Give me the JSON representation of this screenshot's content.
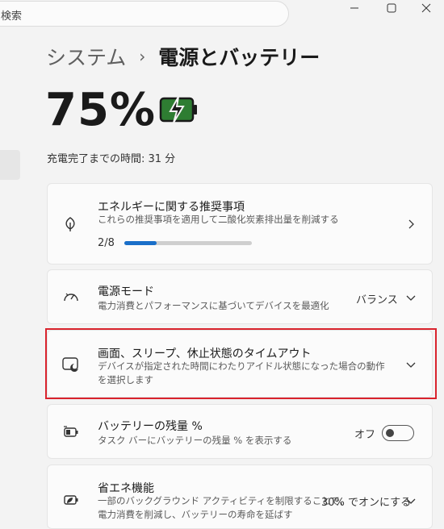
{
  "search": {
    "text": "検索"
  },
  "breadcrumb": {
    "parent": "システム",
    "separator": "›",
    "current": "電源とバッテリー"
  },
  "battery": {
    "percent": "75%",
    "charge_time": "充電完了までの時間: 31 分",
    "charging_color": "#2e7d32"
  },
  "cards": {
    "recommend": {
      "title": "エネルギーに関する推奨事項",
      "desc": "これらの推奨事項を適用して二酸化炭素排出量を削減する",
      "progress_label": "2/8",
      "progress_fraction": 0.25,
      "icon": "leaf-icon"
    },
    "power_mode": {
      "title": "電源モード",
      "desc": "電力消費とパフォーマンスに基づいてデバイスを最適化",
      "value": "バランス",
      "icon": "speedometer-icon"
    },
    "screen_sleep": {
      "title": "画面、スリープ、休止状態のタイムアウト",
      "desc": "デバイスが指定された時間にわたりアイドル状態になった場合の動作を選択します",
      "icon": "screen-moon-icon"
    },
    "battery_percent": {
      "title": "バッテリーの残量 %",
      "desc": "タスク バーにバッテリーの残量 % を表示する",
      "value": "オフ",
      "icon": "battery-icon"
    },
    "energy_saver": {
      "title": "省エネ機能",
      "desc": "一部のバックグラウンド アクティビティを制限することで、電力消費を削減し、バッテリーの寿命を延ばす",
      "value": "30% でオンにする",
      "icon": "energy-saver-icon"
    }
  },
  "colors": {
    "accent": "#1a6fc9",
    "highlight": "#d9232d"
  }
}
